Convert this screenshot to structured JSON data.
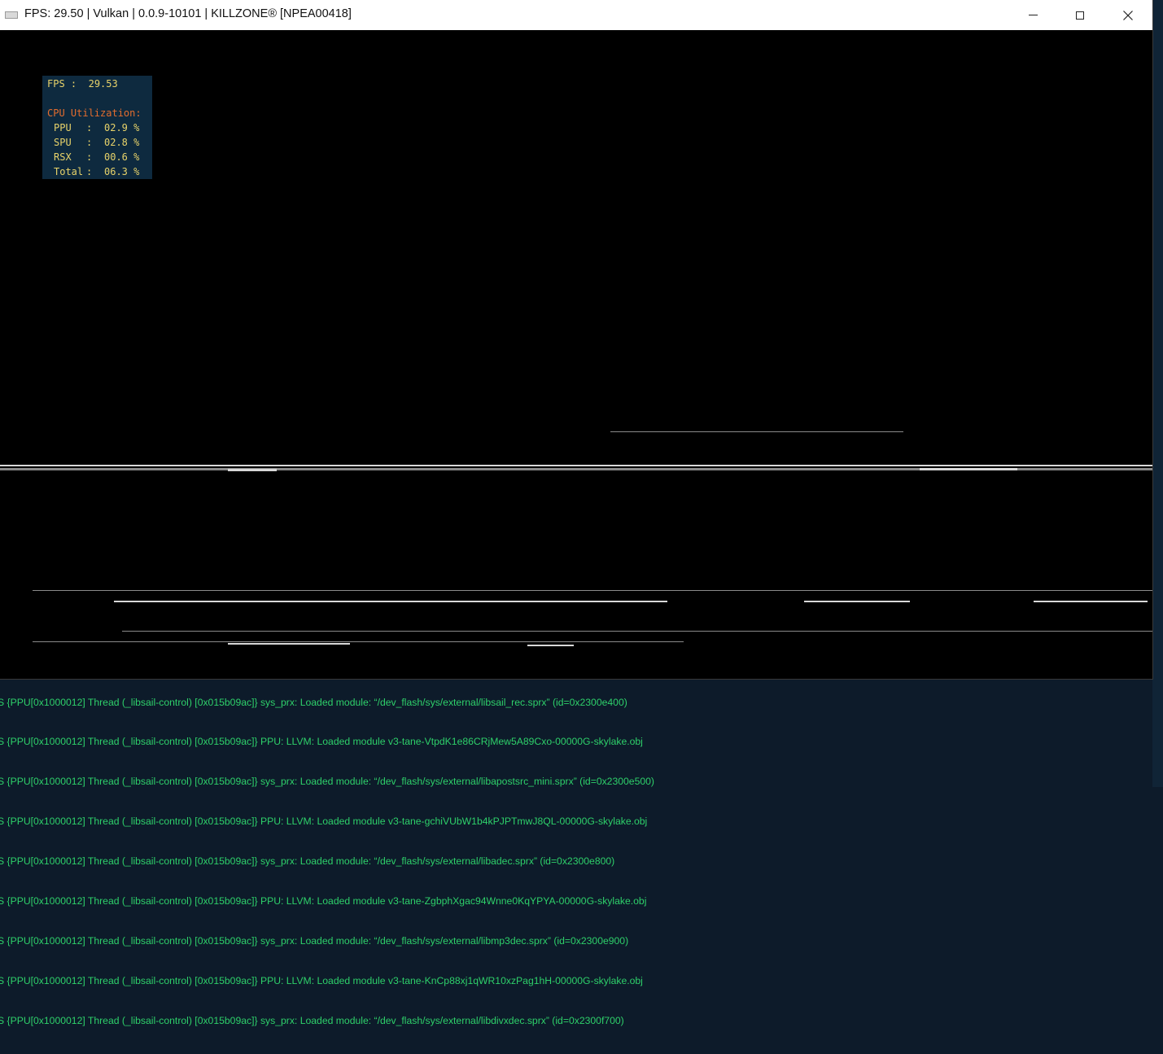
{
  "window": {
    "title": "FPS: 29.50 | Vulkan | 0.0.9-10101 | KILLZONE® [NPEA00418]",
    "icon": "rpcs3-app-icon",
    "controls": {
      "minimize_icon": "minimize-icon",
      "maximize_icon": "maximize-icon",
      "close_icon": "close-icon",
      "close_glyph": "✕"
    }
  },
  "overlay": {
    "fps_label": "FPS",
    "fps_sep": ":",
    "fps_value": "29.53",
    "cpu_title": "CPU Utilization:",
    "rows": [
      {
        "label": "PPU",
        "sep": ":",
        "value": "02.9 %"
      },
      {
        "label": "SPU",
        "sep": ":",
        "value": "02.8 %"
      },
      {
        "label": "RSX",
        "sep": ":",
        "value": "00.6 %"
      },
      {
        "label": "Total",
        "sep": ":",
        "value": "06.3 %"
      }
    ]
  },
  "log": {
    "color": "#2ed06a",
    "lines": [
      "S {PPU[0x1000012] Thread (_libsail-control) [0x015b09ac]} sys_prx: Loaded module: “/dev_flash/sys/external/libsail_rec.sprx” (id=0x2300e400)",
      "S {PPU[0x1000012] Thread (_libsail-control) [0x015b09ac]} PPU: LLVM: Loaded module v3-tane-VtpdK1e86CRjMew5A89Cxo-00000G-skylake.obj",
      "S {PPU[0x1000012] Thread (_libsail-control) [0x015b09ac]} sys_prx: Loaded module: “/dev_flash/sys/external/libapostsrc_mini.sprx” (id=0x2300e500)",
      "S {PPU[0x1000012] Thread (_libsail-control) [0x015b09ac]} PPU: LLVM: Loaded module v3-tane-gchiVUbW1b4kPJPTmwJ8QL-00000G-skylake.obj",
      "S {PPU[0x1000012] Thread (_libsail-control) [0x015b09ac]} sys_prx: Loaded module: “/dev_flash/sys/external/libadec.sprx” (id=0x2300e800)",
      "S {PPU[0x1000012] Thread (_libsail-control) [0x015b09ac]} PPU: LLVM: Loaded module v3-tane-ZgbphXgac94Wnne0KqYPYA-00000G-skylake.obj",
      "S {PPU[0x1000012] Thread (_libsail-control) [0x015b09ac]} sys_prx: Loaded module: “/dev_flash/sys/external/libmp3dec.sprx” (id=0x2300e900)",
      "S {PPU[0x1000012] Thread (_libsail-control) [0x015b09ac]} PPU: LLVM: Loaded module v3-tane-KnCp88xj1qWR10xzPag1hH-00000G-skylake.obj",
      "S {PPU[0x1000012] Thread (_libsail-control) [0x015b09ac]} sys_prx: Loaded module: “/dev_flash/sys/external/libdivxdec.sprx” (id=0x2300f700)"
    ]
  }
}
